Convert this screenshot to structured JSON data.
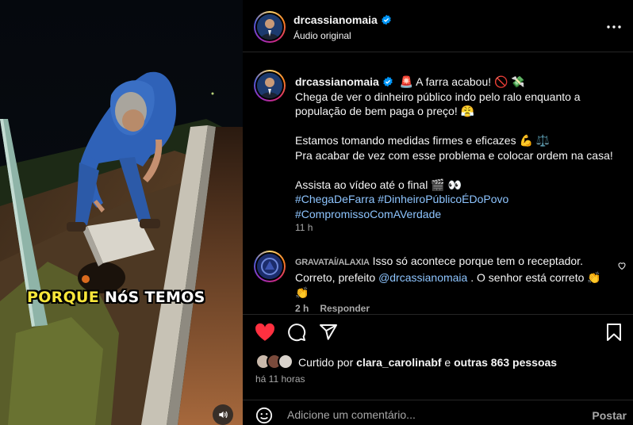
{
  "video": {
    "overlay_highlight": "PORQUE",
    "overlay_rest": " NóS TEMOS"
  },
  "header": {
    "username": "drcassianomaia",
    "subtitle": "Áudio original"
  },
  "caption": {
    "username": "drcassianomaia",
    "lines": [
      "🚨 A farra acabou! 🚫 💸",
      "Chega de ver o dinheiro público indo pelo ralo enquanto a",
      "população de bem paga o preço! 😤",
      "",
      "Estamos tomando medidas firmes e eficazes 💪 ⚖️",
      "Pra acabar de vez com esse problema e colocar ordem na casa!",
      "",
      "Assista ao vídeo até o final 🎬 👀"
    ],
    "hashtags_line1": "#ChegaDeFarra #DinheiroPúblicoÉDoPovo",
    "hashtags_line2": "#CompromissoComAVerdade",
    "time": "11 h"
  },
  "comment": {
    "username": "GRAVATAÍ/ALAXIA",
    "text_part1": " Isso só acontece porque tem o receptador.",
    "text_part2": "Correto, prefeito ",
    "mention": "@drcassianomaia",
    "text_part3": " . O senhor está correto 👏",
    "text_part4": "👏",
    "time": "2 h",
    "reply_label": "Responder"
  },
  "likes": {
    "prefix": "Curtido por ",
    "user": "clara_carolinabf",
    "middle": " e ",
    "others": "outras 863 pessoas"
  },
  "post_time": "há 11 horas",
  "add_comment": {
    "placeholder": "Adicione um comentário...",
    "post_label": "Postar"
  },
  "colors": {
    "like_red": "#ff3040",
    "link_blue": "#8ec5ff",
    "verified_blue": "#0095f6",
    "overlay_yellow": "#f7e63a"
  }
}
